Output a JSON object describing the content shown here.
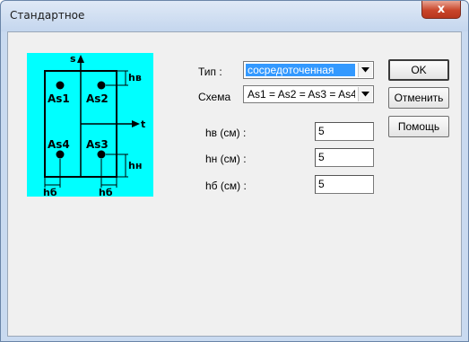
{
  "window": {
    "title": "Стандартное",
    "close_glyph": "x"
  },
  "diagram": {
    "axis_s": "s",
    "axis_t": "t",
    "bars": [
      "As1",
      "As2",
      "As4",
      "As3"
    ],
    "dim_top": "hв",
    "dim_bottom": "hн",
    "dim_side_left": "hб",
    "dim_side_right": "hб",
    "background_color": "#00ffff"
  },
  "form": {
    "type_label": "Тип :",
    "type_value": "сосредоточенная",
    "scheme_label": "Схема",
    "scheme_value": "As1 = As2 = As3 = As4",
    "hv_label": "hв (см) :",
    "hv_value": "5",
    "hn_label": "hн (см) :",
    "hn_value": "5",
    "hb_label": "hб (см) :",
    "hb_value": "5"
  },
  "buttons": {
    "ok": "OK",
    "cancel": "Отменить",
    "help": "Помощь"
  }
}
